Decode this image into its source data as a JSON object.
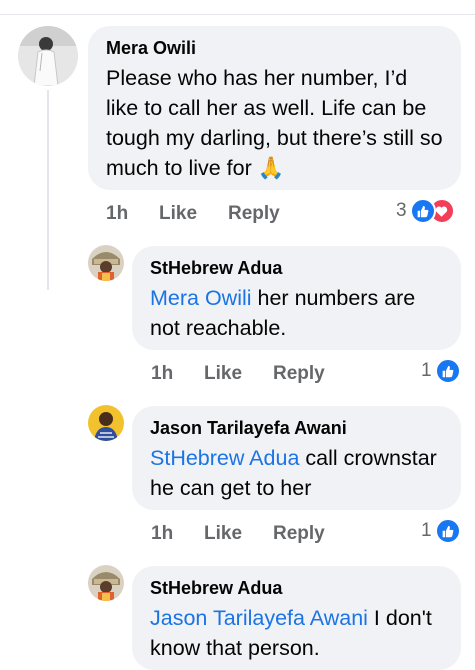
{
  "comments": [
    {
      "author": "Mera Owili",
      "text": "Please who has her number, I’d like to call her as well.  Life can be tough my darling, but there’s still so much to live for 🙏",
      "time": "1h",
      "like": "Like",
      "reply": "Reply",
      "reaction_count": "3"
    },
    {
      "author": "StHebrew Adua",
      "mention": "Mera Owili",
      "text": " her numbers are not reachable.",
      "time": "1h",
      "like": "Like",
      "reply": "Reply",
      "reaction_count": "1"
    },
    {
      "author": "Jason Tarilayefa Awani",
      "mention": "StHebrew Adua",
      "text": " call crownstar he can get to her",
      "time": "1h",
      "like": "Like",
      "reply": "Reply",
      "reaction_count": "1"
    },
    {
      "author": "StHebrew Adua",
      "mention": "Jason Tarilayefa Awani",
      "text": " I don't know that person."
    }
  ],
  "colors": {
    "mention": "#1b74e4",
    "meta": "#65676b",
    "bubble": "#f0f2f5",
    "like": "#1877f2",
    "love": "#f33e58"
  }
}
